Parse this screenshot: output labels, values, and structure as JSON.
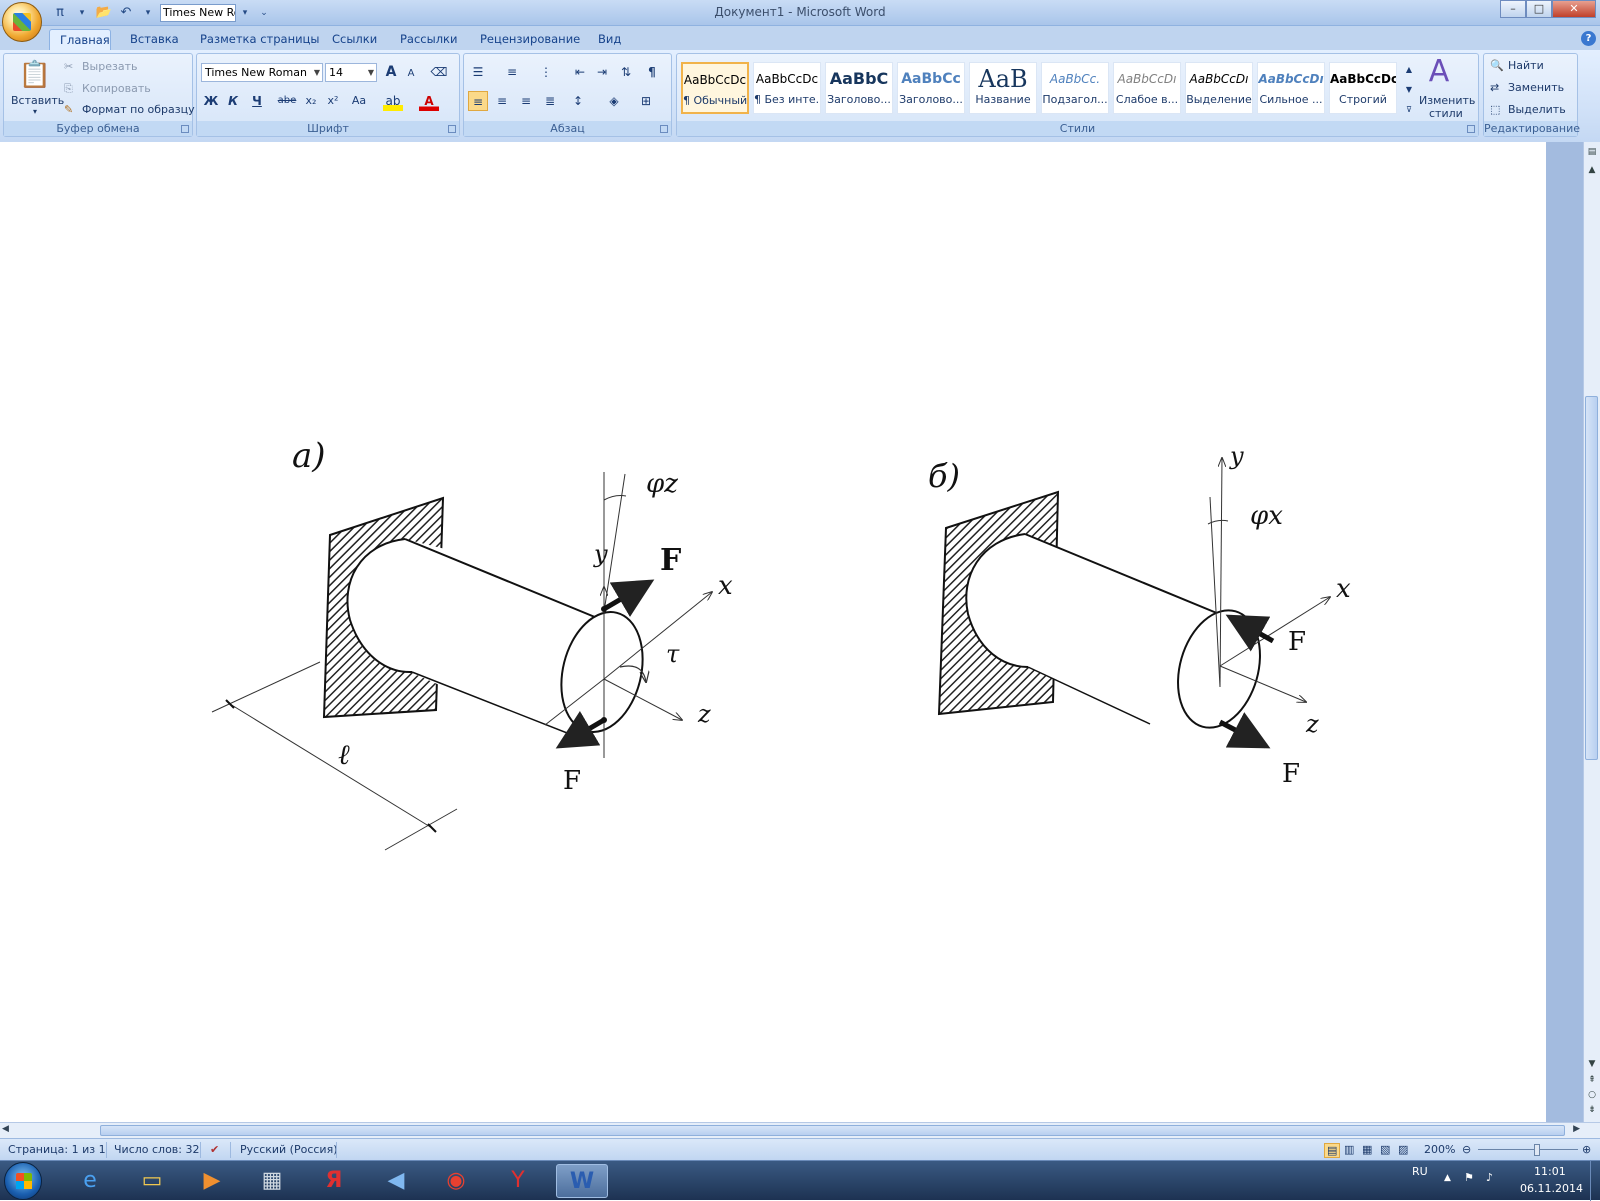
{
  "title_bar": {
    "window_title": "Документ1 - Microsoft Word",
    "qat_font": "Times New Ro",
    "qat_pi_label": "π",
    "min": "–",
    "max": "□",
    "close": "✕"
  },
  "tabs": [
    "Главная",
    "Вставка",
    "Разметка страницы",
    "Ссылки",
    "Рассылки",
    "Рецензирование",
    "Вид"
  ],
  "clipboard": {
    "paste": "Вставить",
    "cut": "Вырезать",
    "copy": "Копировать",
    "format_painter": "Формат по образцу",
    "label": "Буфер обмена"
  },
  "font": {
    "name": "Times New Roman",
    "size": "14",
    "bold": "Ж",
    "italic": "К",
    "underline": "Ч",
    "strike": "abe",
    "sub": "x₂",
    "sup": "x²",
    "case": "Aa",
    "grow": "A",
    "shrink": "A",
    "label": "Шрифт"
  },
  "paragraph": {
    "label": "Абзац",
    "pilcrow": "¶"
  },
  "styles": {
    "items": [
      {
        "sample": "AaBbCcDc",
        "name": "¶ Обычный"
      },
      {
        "sample": "AaBbCcDc",
        "name": "¶ Без инте..."
      },
      {
        "sample": "AaBbC",
        "name": "Заголово..."
      },
      {
        "sample": "AaBbCc",
        "name": "Заголово..."
      },
      {
        "sample": "AaB",
        "name": "Название"
      },
      {
        "sample": "AaBbCc.",
        "name": "Подзагол..."
      },
      {
        "sample": "AaBbCcDı",
        "name": "Слабое в..."
      },
      {
        "sample": "AaBbCcDı",
        "name": "Выделение"
      },
      {
        "sample": "AaBbCcDı",
        "name": "Сильное ..."
      },
      {
        "sample": "AaBbCcDc",
        "name": "Строгий"
      }
    ],
    "change_styles_1": "Изменить",
    "change_styles_2": "стили",
    "label": "Стили"
  },
  "editing": {
    "find": "Найти",
    "replace": "Заменить",
    "select": "Выделить",
    "label": "Редактирование"
  },
  "figure": {
    "label_a": "а)",
    "label_b": "б)",
    "y": "y",
    "x": "x",
    "z": "z",
    "F": "F",
    "phi_z": "φz",
    "phi_x": "φx",
    "tau": "τ",
    "l": "ℓ"
  },
  "status_bar": {
    "page": "Страница: 1 из 1",
    "words": "Число слов: 32",
    "language": "Русский (Россия)",
    "zoom": "200%"
  },
  "taskbar": {
    "lang": "RU",
    "time": "11:01",
    "date": "06.11.2014",
    "apps": [
      "ie-icon",
      "explorer-icon",
      "media-player-icon",
      "calculator-icon",
      "yandex-icon",
      "speaker-app-icon",
      "chrome-icon",
      "yandex-browser-icon",
      "word-icon"
    ]
  }
}
